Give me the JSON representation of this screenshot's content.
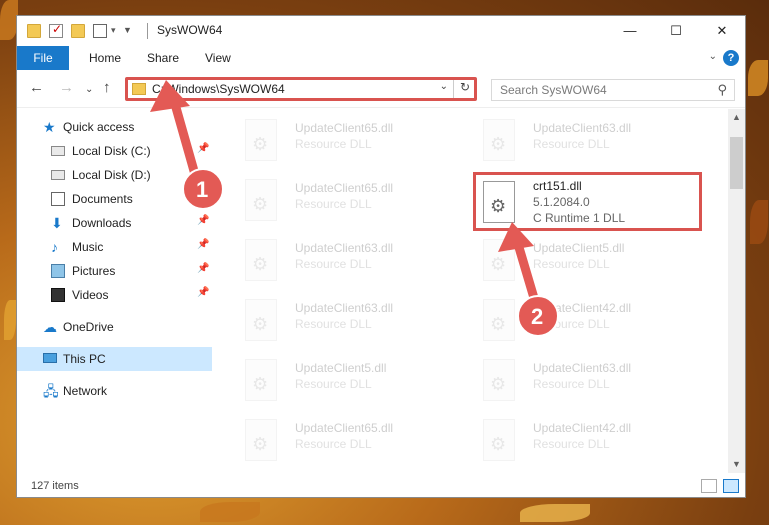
{
  "window": {
    "title": "SysWOW64"
  },
  "window_buttons": {
    "minimize": "—",
    "maximize": "☐",
    "close": "✕"
  },
  "ribbon": {
    "file": "File",
    "tabs": [
      "Home",
      "Share",
      "View"
    ],
    "help": "?"
  },
  "address": {
    "path": "C:\\Windows\\SysWOW64",
    "dropdown": "⌄",
    "refresh": "↻"
  },
  "search": {
    "placeholder": "Search SysWOW64"
  },
  "sidebar": {
    "quick_access": "Quick access",
    "items": [
      {
        "label": "Local Disk (C:)",
        "pinned": true
      },
      {
        "label": "Local Disk (D:)",
        "pinned": false
      },
      {
        "label": "Documents",
        "pinned": true
      },
      {
        "label": "Downloads",
        "pinned": true
      },
      {
        "label": "Music",
        "pinned": true
      },
      {
        "label": "Pictures",
        "pinned": true
      },
      {
        "label": "Videos",
        "pinned": true
      }
    ],
    "onedrive": "OneDrive",
    "this_pc": "This PC",
    "network": "Network"
  },
  "files": {
    "left": [
      {
        "name": "UpdateClient65.dll",
        "type": "Resource DLL"
      },
      {
        "name": "UpdateClient65.dll",
        "type": "Resource DLL"
      },
      {
        "name": "UpdateClient63.dll",
        "type": "Resource DLL"
      },
      {
        "name": "UpdateClient63.dll",
        "type": "Resource DLL"
      },
      {
        "name": "UpdateClient5.dll",
        "type": "Resource DLL"
      },
      {
        "name": "UpdateClient65.dll",
        "type": "Resource DLL"
      }
    ],
    "right": [
      {
        "name": "UpdateClient63.dll",
        "type": "Resource DLL"
      },
      {
        "name": "UpdateClient5.dll",
        "type": "Resource DLL"
      },
      {
        "name": "UpdateClient42.dll",
        "type": "Resource DLL"
      },
      {
        "name": "UpdateClient63.dll",
        "type": "Resource DLL"
      },
      {
        "name": "UpdateClient42.dll",
        "type": "Resource DLL"
      }
    ],
    "highlighted": {
      "name": "crt151.dll",
      "version": "5.1.2084.0",
      "description": "C Runtime 1 DLL"
    }
  },
  "status": {
    "items": "127 items"
  },
  "annotations": {
    "step1": "1",
    "step2": "2"
  },
  "colors": {
    "accent": "#1979ca",
    "highlight": "#d9534f",
    "selected_bg": "#cce8ff"
  }
}
